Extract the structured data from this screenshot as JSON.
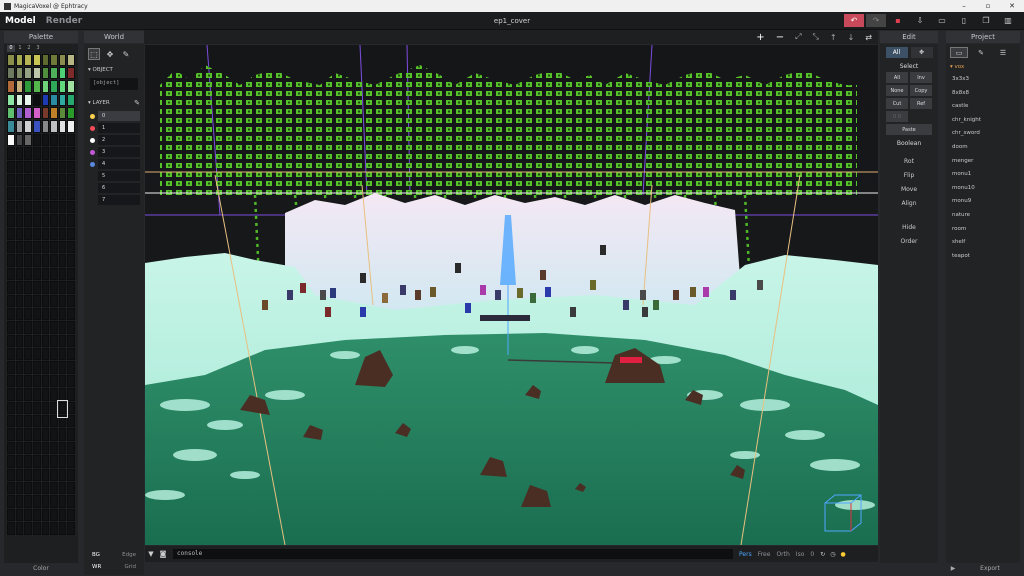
{
  "window": {
    "title": "MagicaVoxel @ Ephtracy",
    "document": "ep1_cover"
  },
  "modes": {
    "model": "Model",
    "render": "Render"
  },
  "palette": {
    "header": "Palette",
    "tabs": [
      "0",
      "1",
      "2",
      "3"
    ],
    "footer": "Color",
    "colors": [
      "#8a8f4a",
      "#a5a94f",
      "#b6b454",
      "#c8c555",
      "#5e6a2e",
      "#6f7a38",
      "#8b8d4e",
      "#b8b683",
      "#6e7a5f",
      "#7f8c67",
      "#94a283",
      "#bdc6a9",
      "#4f8f3e",
      "#4fb05a",
      "#4fcf76",
      "#7f2a2a",
      "#b36a3a",
      "#c9b07a",
      "#2f9a3a",
      "#54b64b",
      "#6fd37a",
      "#2fa85a",
      "#5fd77a",
      "#9fe29f",
      "#8be6a3",
      "#d8f0dc",
      "#e8f6ee",
      "#0c0d0e",
      "#1e3bb4",
      "#2d8aa3",
      "#2faaa0",
      "#26a86f",
      "#5fbf6e",
      "#6e5fbf",
      "#b05fd0",
      "#d45fc8",
      "#7a3a2a",
      "#c0802a",
      "#5a8a3a",
      "#2a9a2a",
      "#3a8a9a",
      "#a0a0a0",
      "#d0d0d0",
      "#3a52c0",
      "#888888",
      "#c0c0c0",
      "#e0e0e0",
      "#f0f0f0",
      "#fafafa",
      "#444444",
      "#666666"
    ]
  },
  "world": {
    "header": "World",
    "object_label": "OBJECT",
    "object_value": "[object]",
    "layer_label": "LAYER",
    "layers": [
      {
        "id": "0",
        "color": "#ffd04d"
      },
      {
        "id": "1",
        "color": "#ff4a5a"
      },
      {
        "id": "2",
        "color": "#ffffff"
      },
      {
        "id": "3",
        "color": "#c25ad7"
      },
      {
        "id": "4",
        "color": "#5a8ae0"
      },
      {
        "id": "5",
        "color": ""
      },
      {
        "id": "6",
        "color": ""
      },
      {
        "id": "7",
        "color": ""
      }
    ],
    "footer": {
      "bg": "BG",
      "edge": "Edge",
      "wr": "WR",
      "grid": "Grid"
    }
  },
  "viewport": {
    "console_text": "console",
    "view_modes": [
      "Pers",
      "Free",
      "Orth",
      "Iso"
    ],
    "zero": "0"
  },
  "edit": {
    "header": "Edit",
    "all": "All",
    "select_label": "Select",
    "select_buttons": [
      "All",
      "Inv",
      "None",
      "Copy",
      "Cut",
      "Ref",
      "0 0",
      "Paste"
    ],
    "boolean": "Boolean",
    "actions": [
      "Rot",
      "Flip",
      "Move",
      "Align",
      "Hide",
      "Order"
    ]
  },
  "project": {
    "header": "Project",
    "folder": "vox",
    "items": [
      "3x3x3",
      "8x8x8",
      "castle",
      "chr_knight",
      "chr_sword",
      "doom",
      "menger",
      "monu1",
      "monu10",
      "monu9",
      "nature",
      "room",
      "shelf",
      "teapot"
    ],
    "footer": "Export"
  },
  "colors": {
    "accent": "#4ba8ff",
    "undo": "#c84a5a",
    "water": "#1f7a5a",
    "snow": "#b8f2e0"
  }
}
